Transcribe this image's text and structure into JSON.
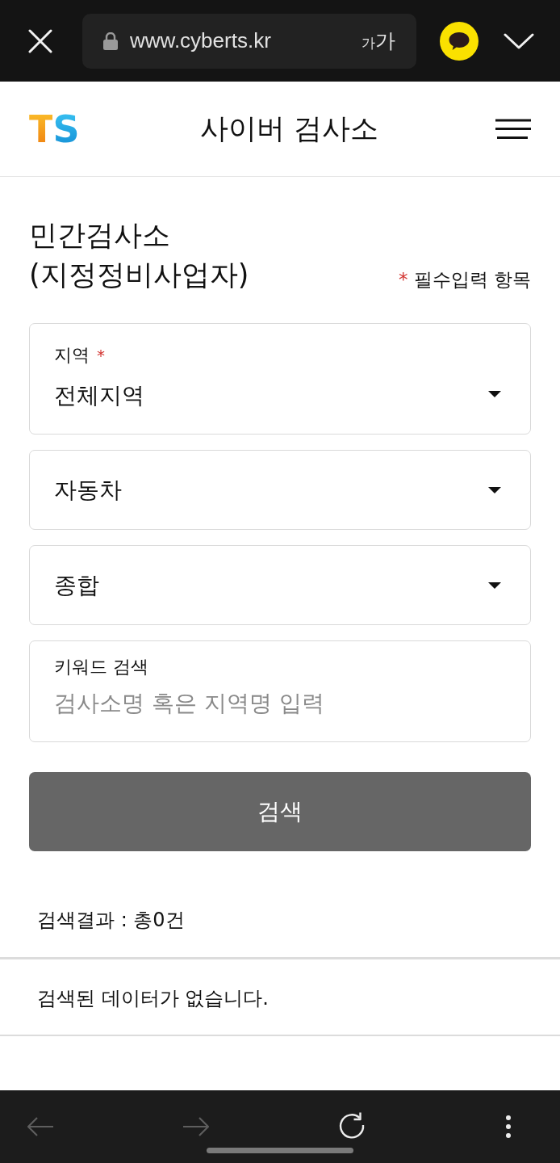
{
  "browser": {
    "url": "www.cyberts.kr",
    "text_size_label": "가가"
  },
  "header": {
    "logo": "TS",
    "title": "사이버 검사소"
  },
  "form": {
    "title_lines": [
      "민간검사소",
      "(지정정비사업자)"
    ],
    "required_note": {
      "mark": "*",
      "text": "필수입력 항목"
    },
    "fields": [
      {
        "kind": "select",
        "label": "지역",
        "required_mark": "*",
        "value": "전체지역"
      },
      {
        "kind": "select",
        "value": "자동차"
      },
      {
        "kind": "select",
        "value": "종합"
      },
      {
        "kind": "text",
        "label": "키워드 검색",
        "placeholder": "검사소명 혹은 지역명 입력"
      }
    ],
    "search_button": "검색"
  },
  "results": {
    "summary": "검색결과 : 총0건",
    "empty_message": "검색된 데이터가 없습니다."
  },
  "nav_buttons": [
    {
      "kind": "back",
      "disabled": true
    },
    {
      "kind": "forward",
      "disabled": true
    },
    {
      "kind": "reload",
      "disabled": false
    },
    {
      "kind": "more",
      "disabled": false
    }
  ]
}
